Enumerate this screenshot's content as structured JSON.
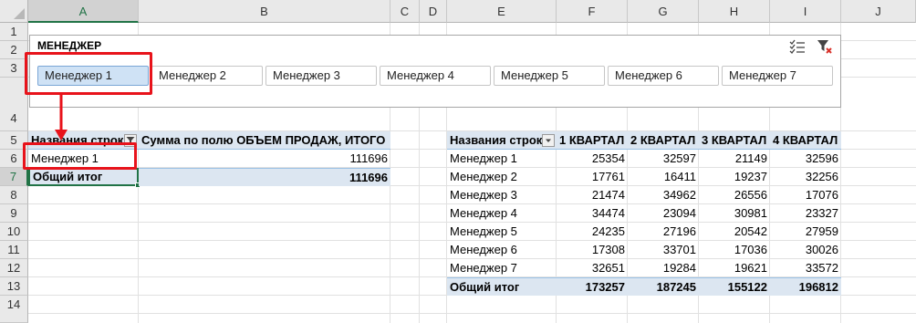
{
  "columns": [
    "A",
    "B",
    "C",
    "D",
    "E",
    "F",
    "G",
    "H",
    "I",
    "J"
  ],
  "rows": [
    "1",
    "2",
    "3",
    "4",
    "5",
    "6",
    "7",
    "8",
    "9",
    "10",
    "11",
    "12",
    "13",
    "14"
  ],
  "slicer": {
    "title": "МЕНЕДЖЕР",
    "items": [
      "Менеджер 1",
      "Менеджер 2",
      "Менеджер 3",
      "Менеджер 4",
      "Менеджер 5",
      "Менеджер 6",
      "Менеджер 7"
    ],
    "selected_index": 0,
    "icons": [
      "multi-select-icon",
      "clear-filter-icon"
    ]
  },
  "pivot1": {
    "row_header": "Названия строк",
    "value_header": "Сумма по полю ОБЪЕМ ПРОДАЖ, ИТОГО",
    "rows": [
      {
        "label": "Менеджер 1",
        "value": "111696"
      }
    ],
    "total_label": "Общий итог",
    "total_value": "111696"
  },
  "pivot2": {
    "row_header": "Названия строк",
    "columns": [
      "1 КВАРТАЛ",
      "2 КВАРТАЛ",
      "3 КВАРТАЛ",
      "4 КВАРТАЛ"
    ],
    "rows": [
      {
        "label": "Менеджер 1",
        "values": [
          "25354",
          "32597",
          "21149",
          "32596"
        ]
      },
      {
        "label": "Менеджер 2",
        "values": [
          "17761",
          "16411",
          "19237",
          "32256"
        ]
      },
      {
        "label": "Менеджер 3",
        "values": [
          "21474",
          "34962",
          "26556",
          "17076"
        ]
      },
      {
        "label": "Менеджер 4",
        "values": [
          "34474",
          "23094",
          "30981",
          "23327"
        ]
      },
      {
        "label": "Менеджер 5",
        "values": [
          "24235",
          "27196",
          "20542",
          "27959"
        ]
      },
      {
        "label": "Менеджер 6",
        "values": [
          "17308",
          "33701",
          "17036",
          "30026"
        ]
      },
      {
        "label": "Менеджер 7",
        "values": [
          "32651",
          "19284",
          "19621",
          "33572"
        ]
      }
    ],
    "total_label": "Общий итог",
    "totals": [
      "173257",
      "187245",
      "155122",
      "196812"
    ]
  },
  "colors": {
    "highlight": "#e8131b",
    "pivot_band": "#dce6f1",
    "slicer_selected": "#cfe2f5",
    "excel_green": "#217346"
  }
}
